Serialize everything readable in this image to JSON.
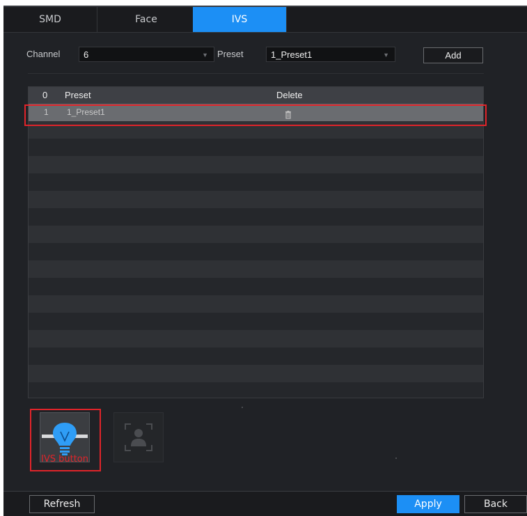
{
  "tabs": [
    {
      "label": "SMD",
      "active": false
    },
    {
      "label": "Face",
      "active": false
    },
    {
      "label": "IVS",
      "active": true
    }
  ],
  "form": {
    "channel_label": "Channel",
    "channel_value": "6",
    "preset_label": "Preset",
    "preset_value": "1_Preset1",
    "add_label": "Add"
  },
  "table": {
    "headers": {
      "index": "0",
      "preset": "Preset",
      "delete": "Delete"
    },
    "rows": [
      {
        "index": "1",
        "preset": "1_Preset1",
        "delete_icon": "trash-icon",
        "selected": true
      }
    ],
    "empty_rows": 16
  },
  "mode_buttons": {
    "ivs_icon": "lightbulb-icon",
    "face_icon": "person-frame-icon",
    "caption": "IVS button"
  },
  "footer": {
    "refresh_label": "Refresh",
    "apply_label": "Apply",
    "back_label": "Back"
  },
  "colors": {
    "accent": "#1c8ff5",
    "highlight": "#e0242a",
    "background": "#202226"
  }
}
